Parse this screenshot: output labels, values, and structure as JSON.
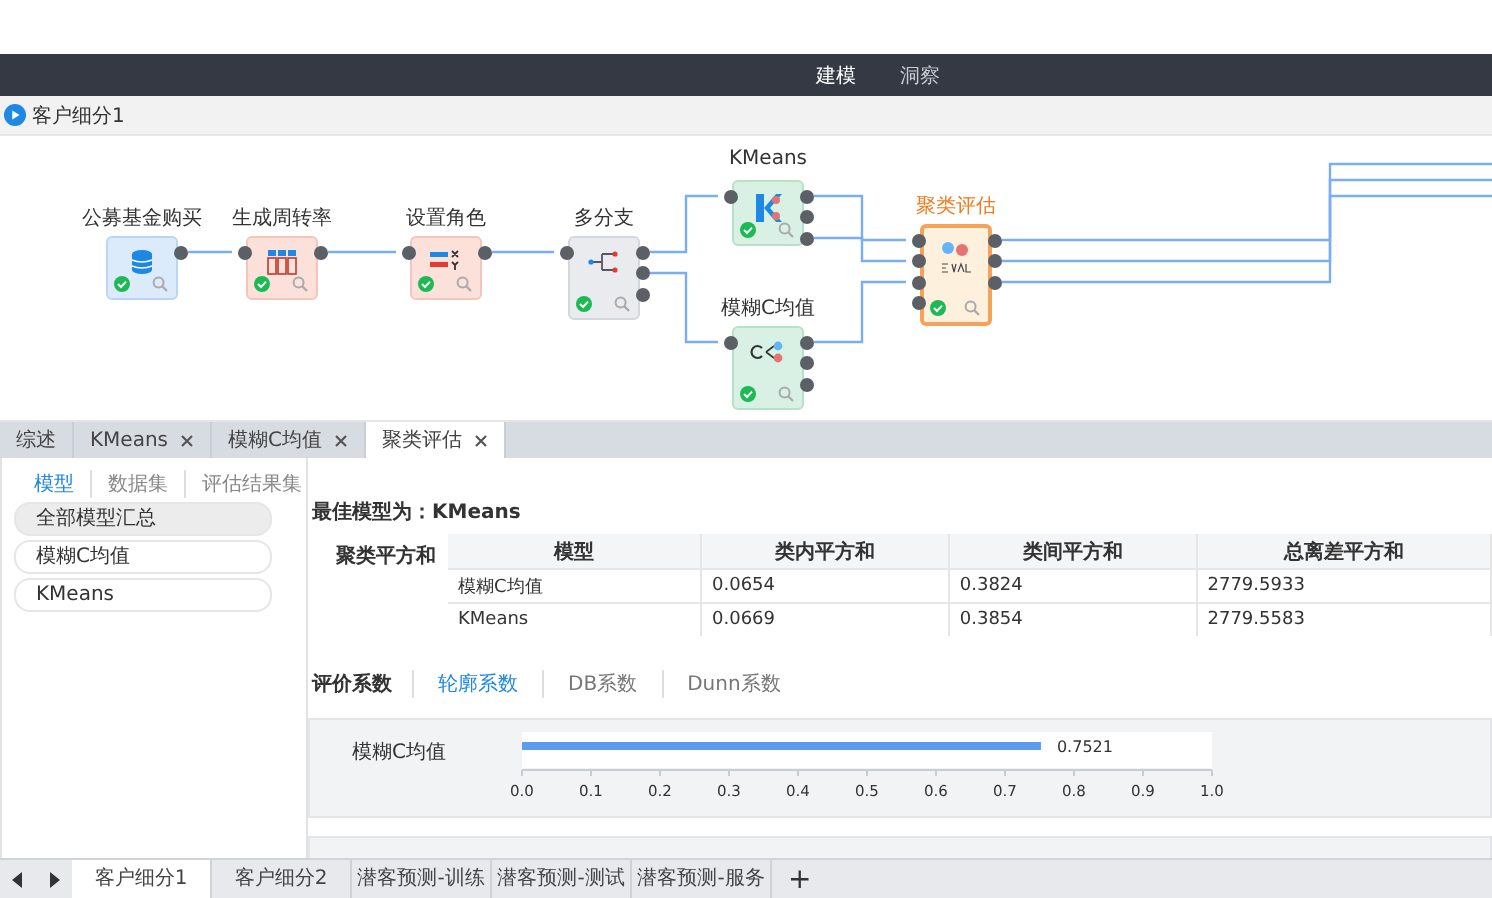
{
  "top_nav": [
    {
      "label": "建模",
      "selected": true
    },
    {
      "label": "洞察",
      "selected": false
    }
  ],
  "breadcrumb": {
    "title": "客户细分1"
  },
  "canvas": {
    "nodes": [
      {
        "label": "公募基金购买",
        "kind": "source",
        "selected": false,
        "done": true
      },
      {
        "label": "生成周转率",
        "kind": "columns",
        "selected": false,
        "done": true
      },
      {
        "label": "设置角色",
        "kind": "roles",
        "selected": false,
        "done": true
      },
      {
        "label": "多分支",
        "kind": "branch",
        "selected": false,
        "done": true
      },
      {
        "label": "KMeans",
        "kind": "kmeans",
        "selected": false,
        "done": true
      },
      {
        "label": "模糊C均值",
        "kind": "fcm",
        "selected": false,
        "done": true
      },
      {
        "label": "聚类评估",
        "kind": "eval",
        "selected": true,
        "done": true
      }
    ]
  },
  "panel_tabs": [
    {
      "label": "综述",
      "closable": false,
      "selected": false
    },
    {
      "label": "KMeans",
      "closable": true,
      "selected": false
    },
    {
      "label": "模糊C均值",
      "closable": true,
      "selected": false
    },
    {
      "label": "聚类评估",
      "closable": true,
      "selected": true
    }
  ],
  "sidebar": {
    "tabs": [
      {
        "label": "模型",
        "selected": true
      },
      {
        "label": "数据集",
        "selected": false
      },
      {
        "label": "评估结果集",
        "selected": false
      }
    ],
    "items": [
      {
        "label": "全部模型汇总",
        "selected": true
      },
      {
        "label": "模糊C均值",
        "selected": false
      },
      {
        "label": "KMeans",
        "selected": false
      }
    ]
  },
  "best_model": {
    "label": "最佳模型为：",
    "value": "KMeans"
  },
  "table": {
    "label": "聚类平方和",
    "columns": [
      "模型",
      "类内平方和",
      "类间平方和",
      "总离差平方和"
    ],
    "rows": [
      [
        "模糊C均值",
        "0.0654",
        "0.3824",
        "2779.5933"
      ],
      [
        "KMeans",
        "0.0669",
        "0.3854",
        "2779.5583"
      ]
    ]
  },
  "metric_tabs": {
    "label": "评价系数",
    "tabs": [
      {
        "label": "轮廓系数",
        "selected": true
      },
      {
        "label": "DB系数",
        "selected": false
      },
      {
        "label": "Dunn系数",
        "selected": false
      }
    ]
  },
  "chart": {
    "chart_data": {
      "type": "bar",
      "orientation": "horizontal",
      "categories": [
        "模糊C均值"
      ],
      "values": [
        0.7521
      ],
      "xlim": [
        0,
        1
      ],
      "xticks": [
        {
          "value": 0,
          "label": "0.0"
        },
        {
          "value": 0.1,
          "label": "0.1"
        },
        {
          "value": 0.2,
          "label": "0.2"
        },
        {
          "value": 0.3,
          "label": "0.3"
        },
        {
          "value": 0.4,
          "label": "0.4"
        },
        {
          "value": 0.5,
          "label": "0.5"
        },
        {
          "value": 0.6,
          "label": "0.6"
        },
        {
          "value": 0.7,
          "label": "0.7"
        },
        {
          "value": 0.8,
          "label": "0.8"
        },
        {
          "value": 0.9,
          "label": "0.9"
        },
        {
          "value": 1,
          "label": "1.0"
        }
      ],
      "data_labels": true
    }
  },
  "bottom_tabs": [
    {
      "label": "客户细分1",
      "selected": true
    },
    {
      "label": "客户细分2",
      "selected": false
    },
    {
      "label": "潜客预测-训练",
      "selected": false
    },
    {
      "label": "潜客预测-测试",
      "selected": false
    },
    {
      "label": "潜客预测-服务",
      "selected": false
    }
  ],
  "add_tab": {
    "label": "+"
  }
}
